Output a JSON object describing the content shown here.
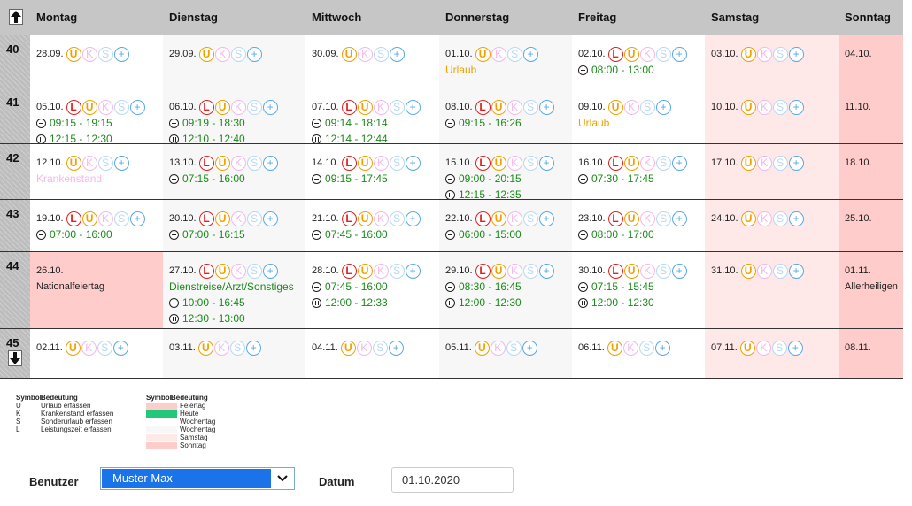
{
  "colors": {
    "holiday": "#ffcccc",
    "today": "#22c77a",
    "saturday": "#ffe8e8",
    "sunday": "#ffcccc"
  },
  "header": {
    "days": [
      "Montag",
      "Dienstag",
      "Mittwoch",
      "Donnerstag",
      "Freitag",
      "Samstag",
      "Sonntag"
    ]
  },
  "weeks": [
    {
      "kw": "40",
      "days": [
        {
          "date": "28.09.",
          "icons": [
            "U",
            "K",
            "S",
            "+"
          ],
          "lines": []
        },
        {
          "date": "29.09.",
          "icons": [
            "U",
            "K",
            "S",
            "+"
          ],
          "lines": []
        },
        {
          "date": "30.09.",
          "icons": [
            "U",
            "K",
            "S",
            "+"
          ],
          "lines": []
        },
        {
          "date": "01.10.",
          "icons": [
            "U",
            "K",
            "S",
            "+"
          ],
          "lines": [
            {
              "kind": "status",
              "style": "orange",
              "text": "Urlaub"
            }
          ]
        },
        {
          "date": "02.10.",
          "icons": [
            "L",
            "U",
            "K",
            "S",
            "+"
          ],
          "lines": [
            {
              "kind": "time",
              "icon": "clock",
              "text": "08:00 - 13:00"
            }
          ]
        },
        {
          "date": "03.10.",
          "icons": [
            "U",
            "K",
            "S",
            "+"
          ],
          "lines": []
        },
        {
          "date": "04.10.",
          "icons": [],
          "lines": []
        }
      ]
    },
    {
      "kw": "41",
      "days": [
        {
          "date": "05.10.",
          "icons": [
            "L",
            "U",
            "K",
            "S",
            "+"
          ],
          "lines": [
            {
              "kind": "time",
              "icon": "clock",
              "text": "09:15 - 19:15"
            },
            {
              "kind": "time",
              "icon": "pause",
              "text": "12:15 - 12:30"
            }
          ]
        },
        {
          "date": "06.10.",
          "icons": [
            "L",
            "U",
            "K",
            "S",
            "+"
          ],
          "lines": [
            {
              "kind": "time",
              "icon": "clock",
              "text": "09:19 - 18:30"
            },
            {
              "kind": "time",
              "icon": "pause",
              "text": "12:10 - 12:40"
            }
          ]
        },
        {
          "date": "07.10.",
          "icons": [
            "L",
            "U",
            "K",
            "S",
            "+"
          ],
          "lines": [
            {
              "kind": "time",
              "icon": "clock",
              "text": "09:14 - 18:14"
            },
            {
              "kind": "time",
              "icon": "pause",
              "text": "12:14 - 12:44"
            }
          ]
        },
        {
          "date": "08.10.",
          "icons": [
            "L",
            "U",
            "K",
            "S",
            "+"
          ],
          "lines": [
            {
              "kind": "time",
              "icon": "clock",
              "text": "09:15 - 16:26"
            }
          ]
        },
        {
          "date": "09.10.",
          "icons": [
            "U",
            "K",
            "S",
            "+"
          ],
          "lines": [
            {
              "kind": "status",
              "style": "orange",
              "text": "Urlaub"
            }
          ]
        },
        {
          "date": "10.10.",
          "icons": [
            "U",
            "K",
            "S",
            "+"
          ],
          "lines": []
        },
        {
          "date": "11.10.",
          "icons": [],
          "lines": []
        }
      ]
    },
    {
      "kw": "42",
      "days": [
        {
          "date": "12.10.",
          "icons": [
            "U",
            "K",
            "S",
            "+"
          ],
          "lines": [
            {
              "kind": "status",
              "style": "pink",
              "text": "Krankenstand"
            }
          ]
        },
        {
          "date": "13.10.",
          "icons": [
            "L",
            "U",
            "K",
            "S",
            "+"
          ],
          "lines": [
            {
              "kind": "time",
              "icon": "clock",
              "text": "07:15 - 16:00"
            }
          ]
        },
        {
          "date": "14.10.",
          "icons": [
            "L",
            "U",
            "K",
            "S",
            "+"
          ],
          "lines": [
            {
              "kind": "time",
              "icon": "clock",
              "text": "09:15 - 17:45"
            }
          ]
        },
        {
          "date": "15.10.",
          "icons": [
            "L",
            "U",
            "K",
            "S",
            "+"
          ],
          "lines": [
            {
              "kind": "time",
              "icon": "clock",
              "text": "09:00 - 20:15"
            },
            {
              "kind": "time",
              "icon": "pause",
              "text": "12:15 - 12:35"
            }
          ]
        },
        {
          "date": "16.10.",
          "icons": [
            "L",
            "U",
            "K",
            "S",
            "+"
          ],
          "lines": [
            {
              "kind": "time",
              "icon": "clock",
              "text": "07:30 - 17:45"
            }
          ]
        },
        {
          "date": "17.10.",
          "icons": [
            "U",
            "K",
            "S",
            "+"
          ],
          "lines": []
        },
        {
          "date": "18.10.",
          "icons": [],
          "lines": []
        }
      ]
    },
    {
      "kw": "43",
      "days": [
        {
          "date": "19.10.",
          "icons": [
            "L",
            "U",
            "K",
            "S",
            "+"
          ],
          "lines": [
            {
              "kind": "time",
              "icon": "clock",
              "text": "07:00 - 16:00"
            }
          ]
        },
        {
          "date": "20.10.",
          "icons": [
            "L",
            "U",
            "K",
            "S",
            "+"
          ],
          "lines": [
            {
              "kind": "time",
              "icon": "clock",
              "text": "07:00 - 16:15"
            }
          ]
        },
        {
          "date": "21.10.",
          "icons": [
            "L",
            "U",
            "K",
            "S",
            "+"
          ],
          "lines": [
            {
              "kind": "time",
              "icon": "clock",
              "text": "07:45 - 16:00"
            }
          ]
        },
        {
          "date": "22.10.",
          "icons": [
            "L",
            "U",
            "K",
            "S",
            "+"
          ],
          "lines": [
            {
              "kind": "time",
              "icon": "clock",
              "text": "06:00 - 15:00"
            }
          ]
        },
        {
          "date": "23.10.",
          "icons": [
            "L",
            "U",
            "K",
            "S",
            "+"
          ],
          "lines": [
            {
              "kind": "time",
              "icon": "clock",
              "text": "08:00 - 17:00"
            }
          ]
        },
        {
          "date": "24.10.",
          "icons": [
            "U",
            "K",
            "S",
            "+"
          ],
          "lines": []
        },
        {
          "date": "25.10.",
          "icons": [],
          "lines": []
        }
      ]
    },
    {
      "kw": "44",
      "days": [
        {
          "date": "26.10.",
          "icons": [],
          "lines": [
            {
              "kind": "plain",
              "text": "Nationalfeiertag"
            }
          ]
        },
        {
          "date": "27.10.",
          "icons": [
            "L",
            "U",
            "K",
            "S",
            "+"
          ],
          "lines": [
            {
              "kind": "status",
              "style": "green",
              "text": "Dienstreise/Arzt/Sonstiges"
            },
            {
              "kind": "time",
              "icon": "clock",
              "text": "10:00 - 16:45"
            },
            {
              "kind": "time",
              "icon": "pause",
              "text": "12:30 - 13:00"
            }
          ]
        },
        {
          "date": "28.10.",
          "icons": [
            "L",
            "U",
            "K",
            "S",
            "+"
          ],
          "lines": [
            {
              "kind": "time",
              "icon": "clock",
              "text": "07:45 - 16:00"
            },
            {
              "kind": "time",
              "icon": "pause",
              "text": "12:00 - 12:33"
            }
          ]
        },
        {
          "date": "29.10.",
          "icons": [
            "L",
            "U",
            "K",
            "S",
            "+"
          ],
          "lines": [
            {
              "kind": "time",
              "icon": "clock",
              "text": "08:30 - 16:45"
            },
            {
              "kind": "time",
              "icon": "pause",
              "text": "12:00 - 12:30"
            }
          ]
        },
        {
          "date": "30.10.",
          "icons": [
            "L",
            "U",
            "K",
            "S",
            "+"
          ],
          "lines": [
            {
              "kind": "time",
              "icon": "clock",
              "text": "07:15 - 15:45"
            },
            {
              "kind": "time",
              "icon": "pause",
              "text": "12:00 - 12:30"
            }
          ]
        },
        {
          "date": "31.10.",
          "icons": [
            "U",
            "K",
            "S",
            "+"
          ],
          "lines": []
        },
        {
          "date": "01.11.",
          "icons": [],
          "lines": [
            {
              "kind": "plain",
              "text": "Allerheiligen"
            }
          ]
        }
      ]
    },
    {
      "kw": "45",
      "days": [
        {
          "date": "02.11.",
          "icons": [
            "U",
            "K",
            "S",
            "+"
          ],
          "lines": []
        },
        {
          "date": "03.11.",
          "icons": [
            "U",
            "K",
            "S",
            "+"
          ],
          "lines": []
        },
        {
          "date": "04.11.",
          "icons": [
            "U",
            "K",
            "S",
            "+"
          ],
          "lines": []
        },
        {
          "date": "05.11.",
          "icons": [
            "U",
            "K",
            "S",
            "+"
          ],
          "lines": []
        },
        {
          "date": "06.11.",
          "icons": [
            "U",
            "K",
            "S",
            "+"
          ],
          "lines": []
        },
        {
          "date": "07.11.",
          "icons": [
            "U",
            "K",
            "S",
            "+"
          ],
          "lines": []
        },
        {
          "date": "08.11.",
          "icons": [],
          "lines": []
        }
      ]
    }
  ],
  "legend": {
    "col1": {
      "h_symbol": "Symbol",
      "h_meaning": "Bedeutung",
      "rows": [
        {
          "sym": "U",
          "text": "Urlaub erfassen"
        },
        {
          "sym": "K",
          "text": "Krankenstand erfassen"
        },
        {
          "sym": "S",
          "text": "Sonderurlaub erfassen"
        },
        {
          "sym": "L",
          "text": "Leistungszeit erfassen"
        }
      ]
    },
    "col2": {
      "h_symbol": "Symbol",
      "h_meaning": "Bedeutung",
      "rows": [
        {
          "color": "#ffcccc",
          "text": "Feiertag"
        },
        {
          "color": "#22c77a",
          "text": "Heute"
        },
        {
          "color": "#ffffff",
          "text": "Wochentag"
        },
        {
          "color": "#f7f7f7",
          "text": "Wochentag"
        },
        {
          "color": "#ffe8e8",
          "text": "Samstag"
        },
        {
          "color": "#ffcccc",
          "text": "Sonntag"
        }
      ]
    }
  },
  "form": {
    "user_label": "Benutzer",
    "user_value": "Muster Max",
    "date_label": "Datum",
    "date_value": "01.10.2020"
  }
}
